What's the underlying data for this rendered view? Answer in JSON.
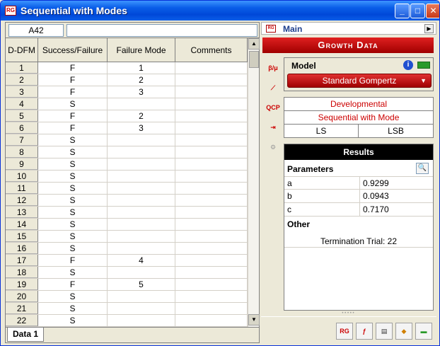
{
  "window": {
    "title": "Sequential with Modes",
    "minimize": "_",
    "maximize": "□",
    "close": "✕"
  },
  "cellref": {
    "address": "A42",
    "formula": ""
  },
  "grid": {
    "headers": [
      "D-DFM",
      "Success/Failure",
      "Failure Mode",
      "Comments"
    ],
    "rows": [
      [
        "1",
        "F",
        "1",
        ""
      ],
      [
        "2",
        "F",
        "2",
        ""
      ],
      [
        "3",
        "F",
        "3",
        ""
      ],
      [
        "4",
        "S",
        "",
        ""
      ],
      [
        "5",
        "F",
        "2",
        ""
      ],
      [
        "6",
        "F",
        "3",
        ""
      ],
      [
        "7",
        "S",
        "",
        ""
      ],
      [
        "8",
        "S",
        "",
        ""
      ],
      [
        "9",
        "S",
        "",
        ""
      ],
      [
        "10",
        "S",
        "",
        ""
      ],
      [
        "11",
        "S",
        "",
        ""
      ],
      [
        "12",
        "S",
        "",
        ""
      ],
      [
        "13",
        "S",
        "",
        ""
      ],
      [
        "14",
        "S",
        "",
        ""
      ],
      [
        "15",
        "S",
        "",
        ""
      ],
      [
        "16",
        "S",
        "",
        ""
      ],
      [
        "17",
        "F",
        "4",
        ""
      ],
      [
        "18",
        "S",
        "",
        ""
      ],
      [
        "19",
        "F",
        "5",
        ""
      ],
      [
        "20",
        "S",
        "",
        ""
      ],
      [
        "21",
        "S",
        "",
        ""
      ],
      [
        "22",
        "S",
        "",
        ""
      ]
    ]
  },
  "sheet_tab": "Data 1",
  "right": {
    "main_label": "Main",
    "banner": "Growth Data",
    "model_title": "Model",
    "model_value": "Standard Gompertz",
    "info": {
      "line1": "Developmental",
      "line2": "Sequential with Mode",
      "left": "LS",
      "right": "LSB"
    },
    "results_title": "Results",
    "parameters_title": "Parameters",
    "params": [
      {
        "name": "a",
        "value": "0.9299"
      },
      {
        "name": "b",
        "value": "0.0943"
      },
      {
        "name": "c",
        "value": "0.7170"
      }
    ],
    "other_title": "Other",
    "termination": "Termination Trial: 22"
  },
  "icons": {
    "side": [
      "beta-mu-icon",
      "line-plot-icon",
      "qcp-icon",
      "export-icon",
      "group-icon"
    ],
    "bottom": [
      "report-icon",
      "function-icon",
      "sheet-icon",
      "diamond-icon",
      "green-bar-icon"
    ]
  },
  "colors": {
    "accent_red": "#c00000",
    "title_blue": "#0a5ee8"
  }
}
